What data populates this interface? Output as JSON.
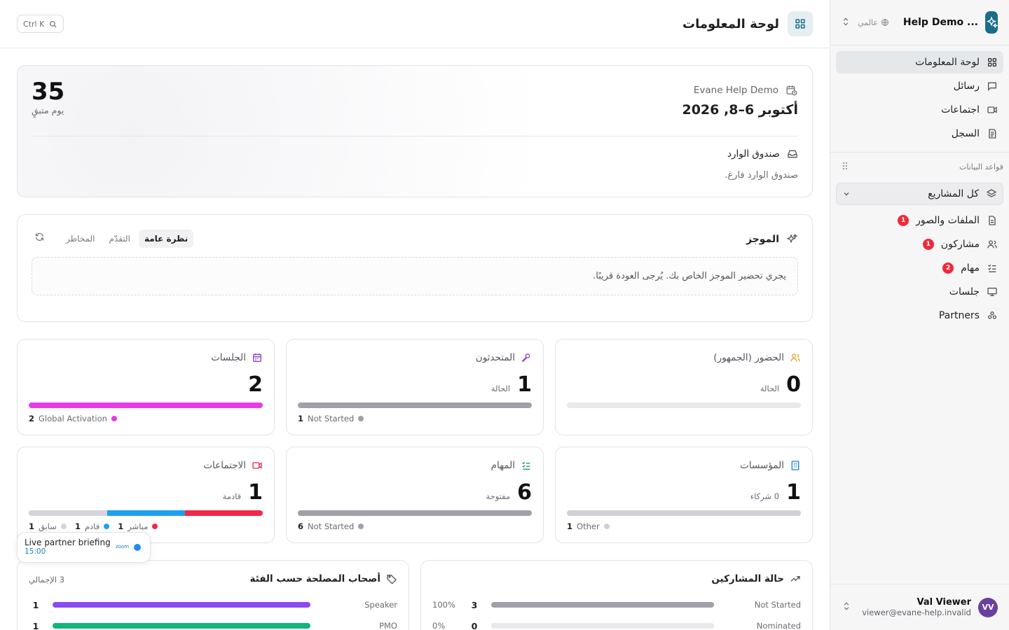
{
  "workspace": {
    "name": "... Help Demo",
    "scope": "عالمي"
  },
  "nav": [
    {
      "label": "لوحة المعلومات",
      "icon": "dashboard-icon",
      "active": true
    },
    {
      "label": "رسائل",
      "icon": "message-icon"
    },
    {
      "label": "اجتماعات",
      "icon": "video-icon"
    },
    {
      "label": "السجل",
      "icon": "log-icon"
    }
  ],
  "databases": {
    "title": "قواعد البيانات",
    "project_select": "كل المشاريع",
    "items": [
      {
        "label": "الملفات والصور",
        "badge": "1",
        "icon": "file-icon"
      },
      {
        "label": "مشاركون",
        "badge": "1",
        "icon": "users-icon"
      },
      {
        "label": "مهام",
        "badge": "2",
        "icon": "tasks-icon"
      },
      {
        "label": "جلسات",
        "badge": "",
        "icon": "presentation-icon"
      },
      {
        "label": "Partners",
        "badge": "",
        "icon": "partners-icon"
      }
    ]
  },
  "user": {
    "initials": "VV",
    "name": "Val Viewer",
    "email": "viewer@evane-help.invalid"
  },
  "topbar": {
    "title": "لوحة المعلومات",
    "search_hint": "Ctrl K"
  },
  "event": {
    "name": "Evane Help Demo",
    "dates": "أكتوبر 6–8, 2026",
    "days_left": "35",
    "days_left_label": "يوم متبقٍ",
    "inbox_title": "صندوق الوارد",
    "inbox_empty": "صندوق الوارد فارغ."
  },
  "brief": {
    "title": "الموجز",
    "tabs": [
      "نظرة عامة",
      "التقدّم",
      "المخاطر"
    ],
    "active_tab": 0,
    "message": "يجري تحضير الموجز الخاص بك. يُرجى العودة قريبًا."
  },
  "stats": {
    "audience": {
      "title": "الحضور (الجمهور)",
      "value": "0",
      "sub": "الحالة",
      "color": "#e0a030"
    },
    "speakers": {
      "title": "المتحدثون",
      "value": "1",
      "sub": "الحالة",
      "legend_count": "1",
      "legend_label": "Not Started",
      "legend_color": "#a0a0a8",
      "fill": 1.0,
      "color": "#8b3fd6"
    },
    "sessions": {
      "title": "الجلسات",
      "value": "2",
      "legend_count": "2",
      "legend_label": "Global Activation",
      "legend_color": "#e83be8",
      "fill": 1.0,
      "color": "#8b3fd6"
    },
    "orgs": {
      "title": "المؤسسات",
      "value": "1",
      "sub": "0 شركاء",
      "legend_count": "1",
      "legend_label": "Other",
      "legend_color": "#d0d0d6",
      "fill": 1.0,
      "color": "#1b82c4"
    },
    "tasks": {
      "title": "المهام",
      "value": "6",
      "sub": "مفتوحة",
      "legend_count": "6",
      "legend_label": "Not Started",
      "legend_color": "#a0a0a8",
      "fill": 1.0,
      "color": "#1a9c6b"
    },
    "meetings": {
      "title": "الاجتماعات",
      "value": "1",
      "sub": "قادمة",
      "color": "#e0284a",
      "segments": [
        {
          "label": "مباشر",
          "count": "1",
          "color": "#f0284a",
          "share": 0.333
        },
        {
          "label": "قادم",
          "count": "1",
          "color": "#1ea0f0",
          "share": 0.333
        },
        {
          "label": "سابق",
          "count": "1",
          "color": "#d4d4da",
          "share": 0.334
        }
      ]
    }
  },
  "stakeholders": {
    "title": "أصحاب المصلحة حسب الفئة",
    "total": "3 الإجمالي",
    "rows": [
      {
        "label": "Speaker",
        "count": "1",
        "color": "#8b4af0",
        "share": 1.0
      },
      {
        "label": "PMO",
        "count": "1",
        "color": "#12b57a",
        "share": 1.0
      }
    ]
  },
  "participants": {
    "title": "حالة المشاركين",
    "rows": [
      {
        "label": "Not Started",
        "count": "3",
        "pct": "100%",
        "color": "#a0a0a8",
        "share": 1.0
      },
      {
        "label": "Nominated",
        "count": "0",
        "pct": "0%",
        "color": "#a0a0a8",
        "share": 0.0
      }
    ]
  },
  "toast": {
    "title": "Live partner briefing",
    "time": "15:00",
    "provider": "zoom"
  }
}
